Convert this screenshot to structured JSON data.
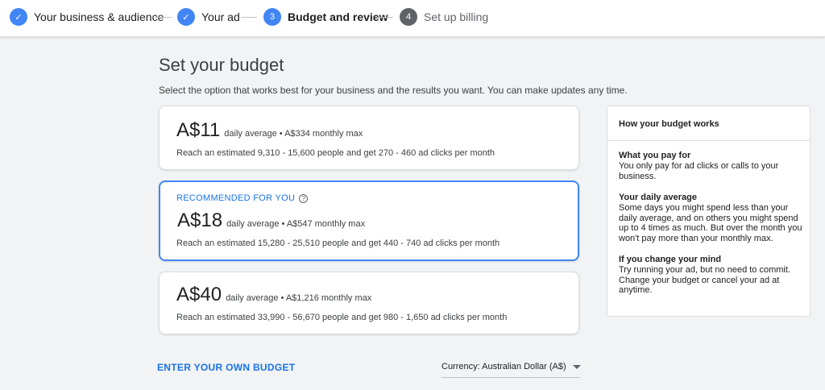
{
  "stepper": {
    "steps": [
      {
        "label": "Your business & audience",
        "status": "done",
        "symbol": "✓"
      },
      {
        "label": "Your ad",
        "status": "done",
        "symbol": "✓"
      },
      {
        "label": "Budget and review",
        "status": "active",
        "symbol": "3"
      },
      {
        "label": "Set up billing",
        "status": "todo",
        "symbol": "4"
      }
    ]
  },
  "main": {
    "title": "Set your budget",
    "subtitle": "Select the option that works best for your business and the results you want. You can make updates any time.",
    "options": [
      {
        "price": "A$11",
        "detail": "daily average • A$334 monthly max",
        "reach": "Reach an estimated 9,310 - 15,600 people and get 270 - 460 ad clicks per month",
        "selected": false
      },
      {
        "recommended_label": "RECOMMENDED FOR YOU",
        "price": "A$18",
        "detail": "daily average • A$547 monthly max",
        "reach": "Reach an estimated 15,280 - 25,510 people and get 440 - 740 ad clicks per month",
        "selected": true
      },
      {
        "price": "A$40",
        "detail": "daily average • A$1,216 monthly max",
        "reach": "Reach an estimated 33,990 - 56,670 people and get 980 - 1,650 ad clicks per month",
        "selected": false
      }
    ],
    "own_budget_label": "ENTER YOUR OWN BUDGET",
    "currency_label": "Currency: Australian Dollar (A$)"
  },
  "side_panel": {
    "title": "How your budget works",
    "sections": [
      {
        "heading": "What you pay for",
        "body": "You only pay for ad clicks or calls to your business."
      },
      {
        "heading": "Your daily average",
        "body": "Some days you might spend less than your daily average, and on others you might spend up to 4 times as much. But over the month you won't pay more than your monthly max."
      },
      {
        "heading": "If you change your mind",
        "body": "Try running your ad, but no need to commit. Change your budget or cancel your ad at anytime."
      }
    ]
  },
  "colors": {
    "accent": "#4285f4",
    "link": "#1a73e8",
    "background": "#f1f3f4"
  }
}
